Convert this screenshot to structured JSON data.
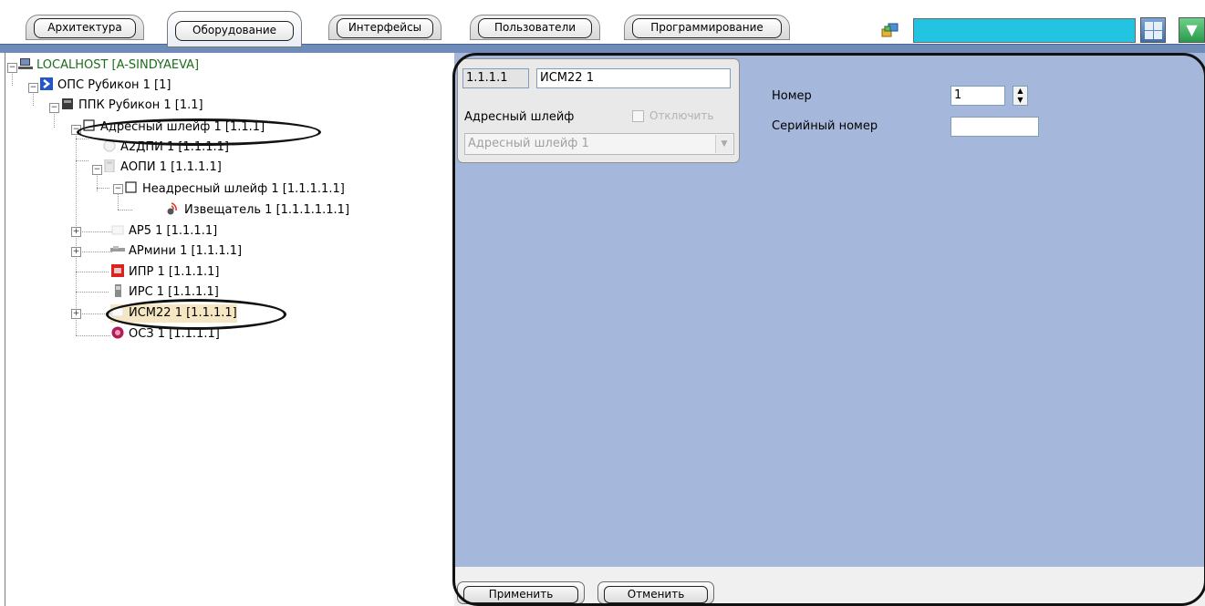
{
  "tabs": [
    {
      "label": "Архитектура",
      "active": false
    },
    {
      "label": "Оборудование",
      "active": true
    },
    {
      "label": "Интерфейсы",
      "active": false
    },
    {
      "label": "Пользователи",
      "active": false
    },
    {
      "label": "Программирование",
      "active": false
    }
  ],
  "toolbar": {
    "search_value": "",
    "icons": [
      "objects-icon",
      "layout-grid-icon",
      "dropdown-arrow-icon"
    ],
    "accent_color": "#22c4e2"
  },
  "tree": {
    "nodes": [
      {
        "label": "LOCALHOST [A-SINDYAEVA]",
        "icon": "computer-icon"
      },
      {
        "label": "ОПС Рубикон 1 [1]",
        "icon": "rubicon-system-icon"
      },
      {
        "label": "ППК Рубикон 1 [1.1]",
        "icon": "control-panel-icon"
      },
      {
        "label": "Адресный шлейф 1 [1.1.1]",
        "icon": "loop-checkbox-icon"
      },
      {
        "label": "А2ДПИ 1 [1.1.1.1]",
        "icon": "detector-icon"
      },
      {
        "label": "АОПИ 1 [1.1.1.1]",
        "icon": "module-icon"
      },
      {
        "label": "Неадресный шлейф 1 [1.1.1.1.1]",
        "icon": "loop-checkbox-icon"
      },
      {
        "label": "Извещатель 1 [1.1.1.1.1.1]",
        "icon": "sensor-icon"
      },
      {
        "label": "АР5 1 [1.1.1.1]",
        "icon": "expander-icon"
      },
      {
        "label": "АРмини 1 [1.1.1.1]",
        "icon": "expander-mini-icon"
      },
      {
        "label": "ИПР 1 [1.1.1.1]",
        "icon": "manual-call-point-icon"
      },
      {
        "label": "ИРС 1 [1.1.1.1]",
        "icon": "relay-icon"
      },
      {
        "label": "ИСМ22 1 [1.1.1.1]",
        "icon": "executive-module-icon"
      },
      {
        "label": "ОСЗ 1 [1.1.1.1]",
        "icon": "siren-icon"
      }
    ]
  },
  "panel": {
    "address": "1.1.1.1",
    "name": "ИСМ22 1",
    "parent_label": "Адресный шлейф",
    "disable_label": "Отключить",
    "disable_checked": false,
    "parent_value": "Адресный шлейф 1",
    "number_label": "Номер",
    "number_value": "1",
    "serial_label": "Серийный номер",
    "serial_value": "",
    "apply_label": "Применить",
    "cancel_label": "Отменить",
    "background_color": "#a6b7dc"
  }
}
